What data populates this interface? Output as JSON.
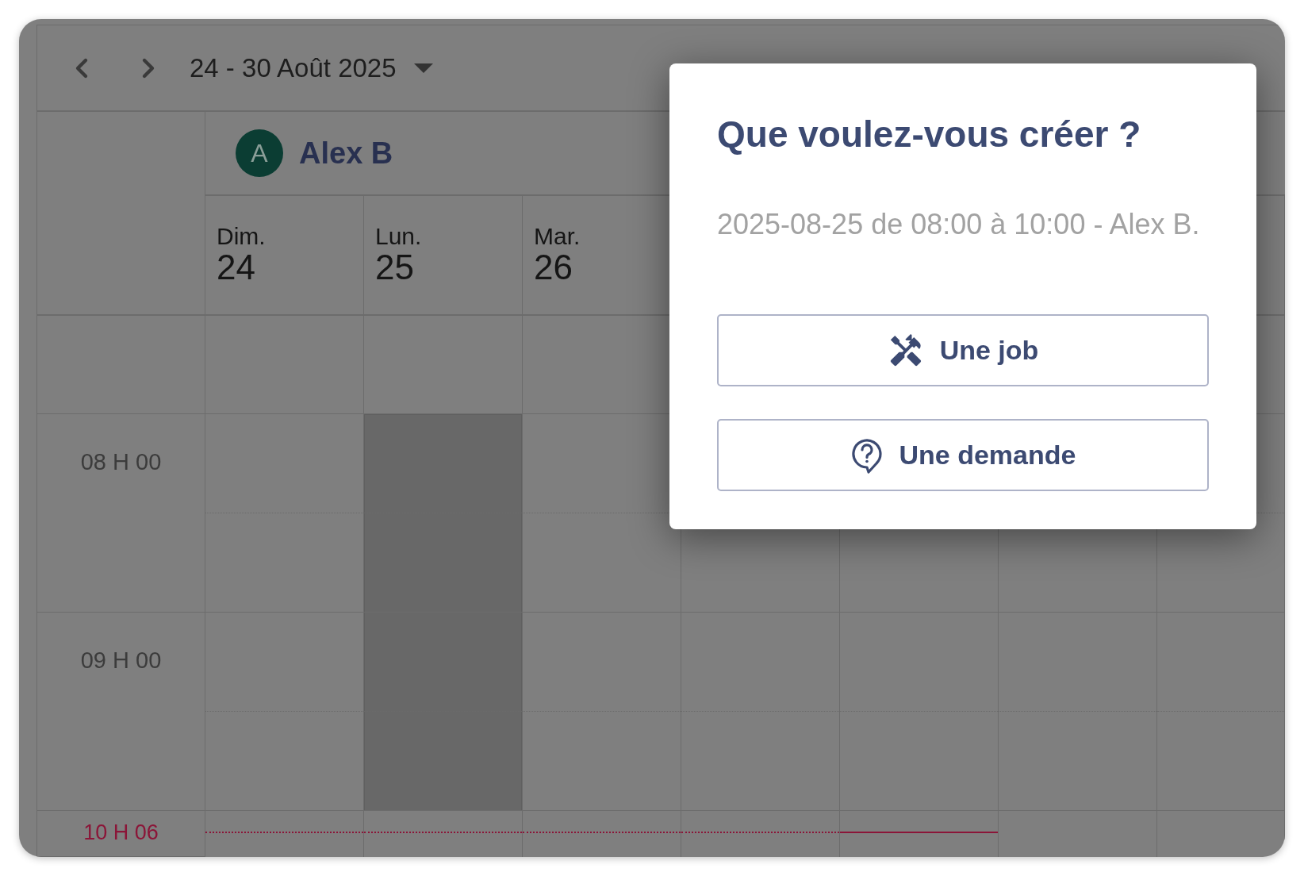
{
  "toolbar": {
    "range_label": "24 - 30 Août 2025"
  },
  "resource": {
    "initial": "A",
    "name": "Alex B"
  },
  "days": [
    {
      "weekday": "Dim.",
      "date": "24",
      "selected": false
    },
    {
      "weekday": "Lun.",
      "date": "25",
      "selected": true
    },
    {
      "weekday": "Mar.",
      "date": "26",
      "selected": false
    }
  ],
  "time_slots": [
    "08 H 00",
    "09 H 00"
  ],
  "now_line": {
    "label": "10 H 06"
  },
  "dialog": {
    "title": "Que voulez-vous créer ?",
    "subtitle": "2025-08-25 de 08:00 à 10:00 - Alex B.",
    "options": [
      {
        "kind": "job",
        "label": "Une job"
      },
      {
        "kind": "request",
        "label": "Une demande"
      }
    ]
  }
}
